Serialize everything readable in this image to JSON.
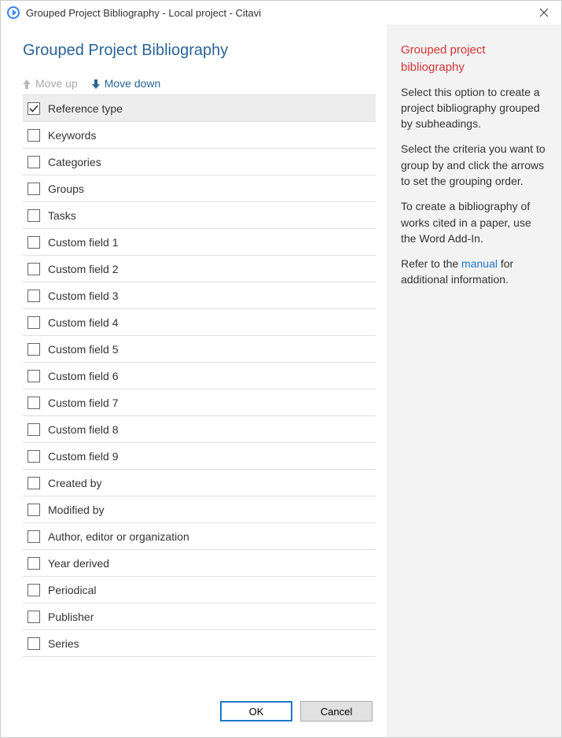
{
  "window": {
    "title": "Grouped Project Bibliography - Local project - Citavi"
  },
  "heading": "Grouped Project Bibliography",
  "toolbar": {
    "move_up": "Move up",
    "move_down": "Move down"
  },
  "items": [
    {
      "label": "Reference type",
      "checked": true,
      "selected": true
    },
    {
      "label": "Keywords",
      "checked": false,
      "selected": false
    },
    {
      "label": "Categories",
      "checked": false,
      "selected": false
    },
    {
      "label": "Groups",
      "checked": false,
      "selected": false
    },
    {
      "label": "Tasks",
      "checked": false,
      "selected": false
    },
    {
      "label": "Custom field 1",
      "checked": false,
      "selected": false
    },
    {
      "label": "Custom field 2",
      "checked": false,
      "selected": false
    },
    {
      "label": "Custom field 3",
      "checked": false,
      "selected": false
    },
    {
      "label": "Custom field 4",
      "checked": false,
      "selected": false
    },
    {
      "label": "Custom field 5",
      "checked": false,
      "selected": false
    },
    {
      "label": "Custom field 6",
      "checked": false,
      "selected": false
    },
    {
      "label": "Custom field 7",
      "checked": false,
      "selected": false
    },
    {
      "label": "Custom field 8",
      "checked": false,
      "selected": false
    },
    {
      "label": "Custom field 9",
      "checked": false,
      "selected": false
    },
    {
      "label": "Created by",
      "checked": false,
      "selected": false
    },
    {
      "label": "Modified by",
      "checked": false,
      "selected": false
    },
    {
      "label": "Author, editor or organization",
      "checked": false,
      "selected": false
    },
    {
      "label": "Year derived",
      "checked": false,
      "selected": false
    },
    {
      "label": "Periodical",
      "checked": false,
      "selected": false
    },
    {
      "label": "Publisher",
      "checked": false,
      "selected": false
    },
    {
      "label": "Series",
      "checked": false,
      "selected": false
    }
  ],
  "buttons": {
    "ok": "OK",
    "cancel": "Cancel"
  },
  "help": {
    "title": "Grouped project bibliography",
    "p1": "Select this option to create a project bibliography grouped by subheadings.",
    "p2": "Select the criteria you want to group by and click the arrows to set the grouping order.",
    "p3": "To create a bibliography of works cited in a paper, use the Word Add-In.",
    "p4_prefix": "Refer to the ",
    "p4_link": "manual",
    "p4_suffix": " for additional information."
  }
}
